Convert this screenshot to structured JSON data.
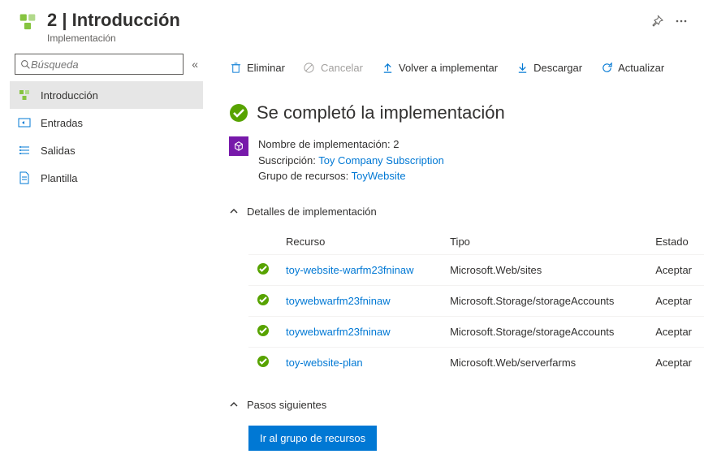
{
  "header": {
    "title": "2 | Introducción",
    "subtitle": "Implementación"
  },
  "sidebar": {
    "search_placeholder": "Búsqueda",
    "items": [
      {
        "label": "Introducción"
      },
      {
        "label": "Entradas"
      },
      {
        "label": "Salidas"
      },
      {
        "label": "Plantilla"
      }
    ]
  },
  "toolbar": {
    "delete": "Eliminar",
    "cancel": "Cancelar",
    "redeploy": "Volver a implementar",
    "download": "Descargar",
    "refresh": "Actualizar"
  },
  "status": {
    "title": "Se completó la implementación"
  },
  "meta": {
    "name_label": "Nombre de implementación:",
    "name_value": "2",
    "subscription_label": "Suscripción:",
    "subscription_value": "Toy Company Subscription",
    "rg_label": "Grupo de recursos:",
    "rg_value": "ToyWebsite"
  },
  "details": {
    "title": "Detalles de implementación",
    "headers": {
      "resource": "Recurso",
      "type": "Tipo",
      "status": "Estado"
    },
    "rows": [
      {
        "resource": "toy-website-warfm23fninaw",
        "type": "Microsoft.Web/sites",
        "status": "Aceptar"
      },
      {
        "resource": "toywebwarfm23fninaw",
        "type": "Microsoft.Storage/storageAccounts",
        "status": "Aceptar"
      },
      {
        "resource": "toywebwarfm23fninaw",
        "type": "Microsoft.Storage/storageAccounts",
        "status": "Aceptar"
      },
      {
        "resource": "toy-website-plan",
        "type": "Microsoft.Web/serverfarms",
        "status": "Aceptar"
      }
    ]
  },
  "next": {
    "title": "Pasos siguientes",
    "button": "Ir al grupo de recursos"
  }
}
